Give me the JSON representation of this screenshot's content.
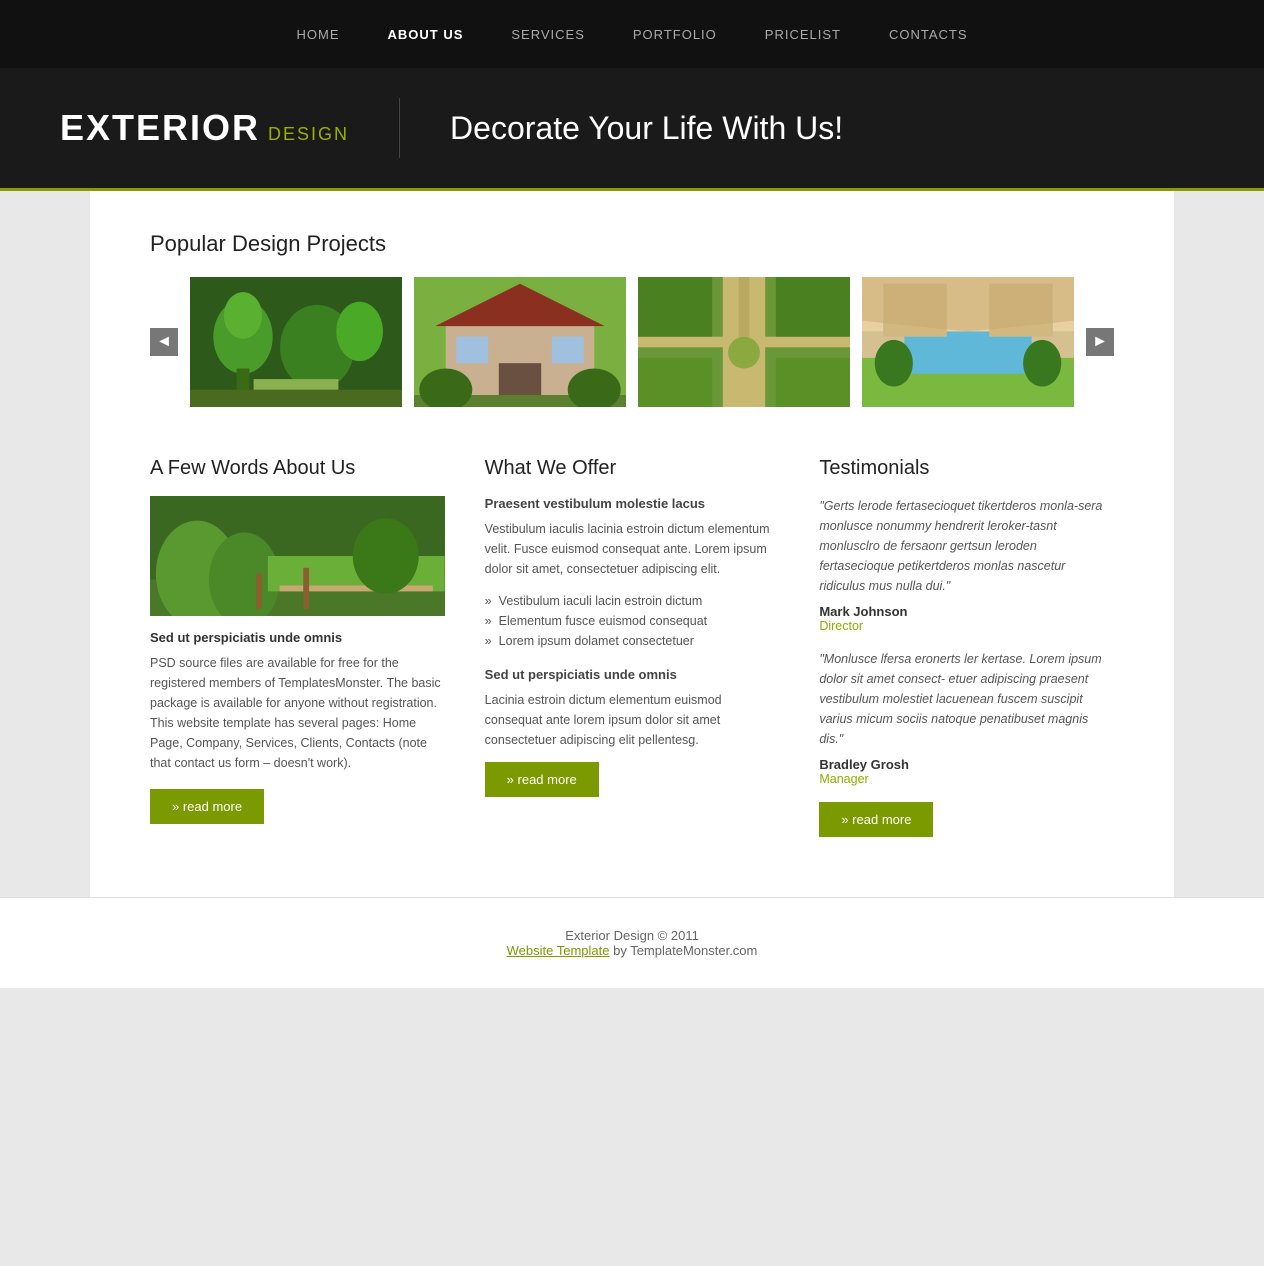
{
  "nav": {
    "items": [
      {
        "label": "HOME",
        "active": false
      },
      {
        "label": "ABOUT US",
        "active": true
      },
      {
        "label": "SERVICES",
        "active": false
      },
      {
        "label": "PORTFOLIO",
        "active": false
      },
      {
        "label": "PRICELIST",
        "active": false
      },
      {
        "label": "CONTACTS",
        "active": false
      }
    ]
  },
  "hero": {
    "logo_main": "EXTERIOR",
    "logo_sub": "DESIGN",
    "tagline": "Decorate Your Life With Us!"
  },
  "gallery": {
    "section_title": "Popular Design Projects",
    "prev_label": "◄",
    "next_label": "►",
    "images": [
      {
        "alt": "Topiary garden",
        "class": "img-garden1"
      },
      {
        "alt": "Red roof house",
        "class": "img-house"
      },
      {
        "alt": "Formal garden path",
        "class": "img-formal"
      },
      {
        "alt": "Pool garden",
        "class": "img-pool"
      }
    ]
  },
  "about": {
    "title": "A Few Words About Us",
    "subtitle": "Sed ut perspiciatis unde omnis",
    "body": "PSD source files are available for free for the registered members of TemplatesMonster. The basic package is available for anyone without registration. This website template has several pages: Home Page, Company, Services, Clients, Contacts (note that contact us form – doesn't work).",
    "read_more": "» read more"
  },
  "offer": {
    "title": "What We Offer",
    "subtitle1": "Praesent vestibulum molestie lacus",
    "text1": "Vestibulum iaculis lacinia estroin dictum elementum velit. Fusce euismod consequat ante. Lorem ipsum dolor sit amet, consectetuer adipiscing elit.",
    "list": [
      "Vestibulum iaculi lacin estroin dictum",
      "Elementum fusce euismod consequat",
      "Lorem ipsum dolamet consectetuer"
    ],
    "subtitle2": "Sed ut perspiciatis unde omnis",
    "text2": "Lacinia estroin dictum elementum euismod consequat ante lorem ipsum dolor sit amet consectetuer adipiscing elit pellentesg.",
    "read_more": "» read more"
  },
  "testimonials": {
    "title": "Testimonials",
    "items": [
      {
        "quote": "\"Gerts lerode fertasecioquet tikertderos monla-sera monlusce nonummy hendrerit leroker-tasnt monlusclro de fersaonr gertsun leroden fertasecioque petikertderos monlas nascetur ridiculus mus nulla dui.\"",
        "name": "Mark Johnson",
        "role": "Director"
      },
      {
        "quote": "\"Monlusce lfersa eronerts ler kertase. Lorem ipsum dolor sit amet consect- etuer adipiscing praesent vestibulum molestiet lacuenean fuscem suscipit varius micum sociis natoque penatibuset magnis dis.\"",
        "name": "Bradley Grosh",
        "role": "Manager"
      }
    ],
    "read_more": "» read more"
  },
  "footer": {
    "copyright": "Exterior Design © 2011",
    "link_text": "Website Template",
    "suffix": " by TemplateMonster.com"
  }
}
